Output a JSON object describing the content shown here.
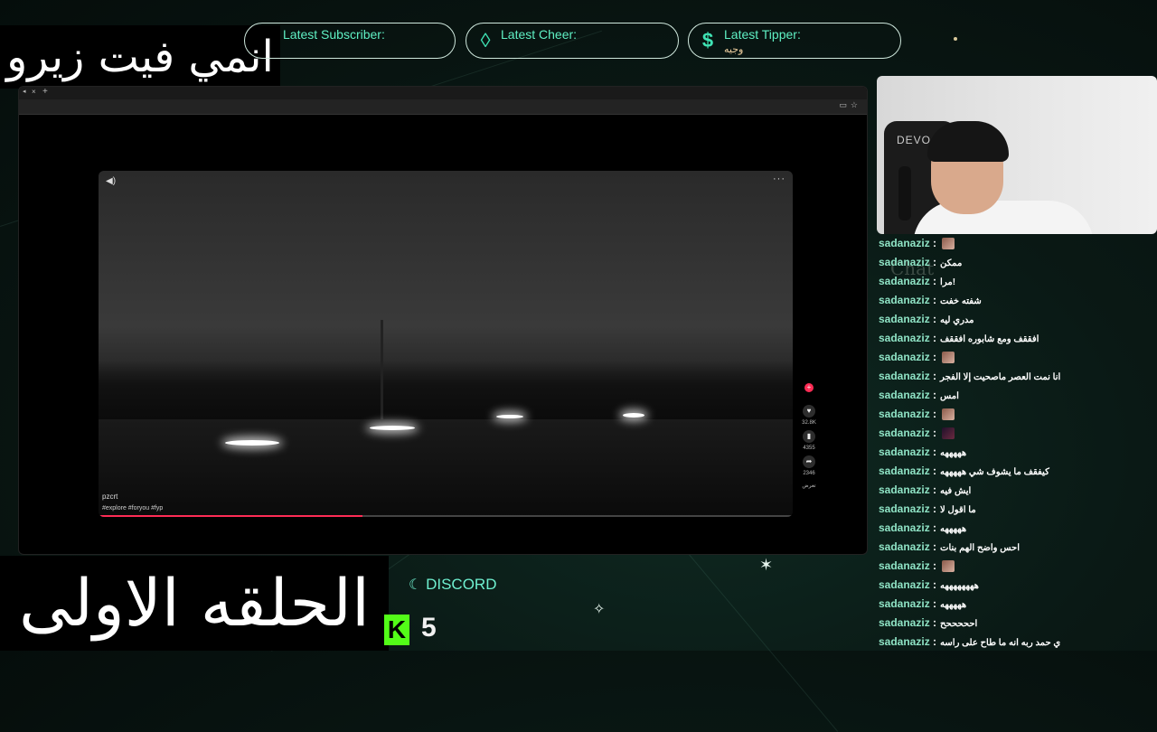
{
  "overlay": {
    "title_top": "انمي فيت زيرو",
    "title_bottom": "الحلقه الاولى",
    "widgets": [
      {
        "icon": "person-icon",
        "label": "Latest Subscriber:",
        "value": ""
      },
      {
        "icon": "diamond-icon",
        "label": "Latest Cheer:",
        "value": ""
      },
      {
        "icon": "dollar-icon",
        "label": "Latest Tipper:",
        "value": "وجيه"
      }
    ],
    "discord_label": "DISCORD",
    "viewer_count": "5",
    "kick_logo_letter": "K",
    "accent": "#3fe3b4"
  },
  "browser": {
    "tab_close": "×",
    "tab_add": "+",
    "video": {
      "author": "pzcrt",
      "caption": "#explore #foryou #fyp",
      "actions": [
        {
          "icon": "heart-icon",
          "count": "32.8K"
        },
        {
          "icon": "bookmark-icon",
          "count": "4355"
        },
        {
          "icon": "share-icon",
          "count": "2346"
        }
      ],
      "more_label": "تعرض",
      "progress": 0.38
    }
  },
  "webcam": {
    "chair_brand": "DEVO"
  },
  "chat": {
    "watermark": "Chat",
    "messages": [
      {
        "user": "sadanaziz",
        "msg": "",
        "emote": "light"
      },
      {
        "user": "sadanaziz",
        "msg": "ممكن",
        "emote": ""
      },
      {
        "user": "sadanaziz",
        "msg": "مرا!",
        "emote": ""
      },
      {
        "user": "sadanaziz",
        "msg": "شفته خفت",
        "emote": ""
      },
      {
        "user": "sadanaziz",
        "msg": "مدري ليه",
        "emote": ""
      },
      {
        "user": "sadanaziz",
        "msg": "افققف ومع شابوره افققف",
        "emote": ""
      },
      {
        "user": "sadanaziz",
        "msg": "",
        "emote": "light"
      },
      {
        "user": "sadanaziz",
        "msg": "انا نمت العصر ماصحيت إلا الفجر",
        "emote": ""
      },
      {
        "user": "sadanaziz",
        "msg": "امس",
        "emote": ""
      },
      {
        "user": "sadanaziz",
        "msg": "",
        "emote": "light"
      },
      {
        "user": "sadanaziz",
        "msg": "",
        "emote": "dark"
      },
      {
        "user": "sadanaziz",
        "msg": "هههههه",
        "emote": ""
      },
      {
        "user": "sadanaziz",
        "msg": "كيفقف ما يشوف شي هههههه",
        "emote": ""
      },
      {
        "user": "sadanaziz",
        "msg": "ايش فيه",
        "emote": ""
      },
      {
        "user": "sadanaziz",
        "msg": "ما اقول لا",
        "emote": ""
      },
      {
        "user": "sadanaziz",
        "msg": "هههههه",
        "emote": ""
      },
      {
        "user": "sadanaziz",
        "msg": "احس واضح الهم بنات",
        "emote": ""
      },
      {
        "user": "sadanaziz",
        "msg": "",
        "emote": "light"
      },
      {
        "user": "sadanaziz",
        "msg": "ههههههههه",
        "emote": ""
      },
      {
        "user": "sadanaziz",
        "msg": "هههههه",
        "emote": ""
      },
      {
        "user": "sadanaziz",
        "msg": "احححححح",
        "emote": ""
      },
      {
        "user": "sadanaziz",
        "msg": "ي حمد ربه انه ما طاح على راسه",
        "emote": ""
      }
    ]
  }
}
